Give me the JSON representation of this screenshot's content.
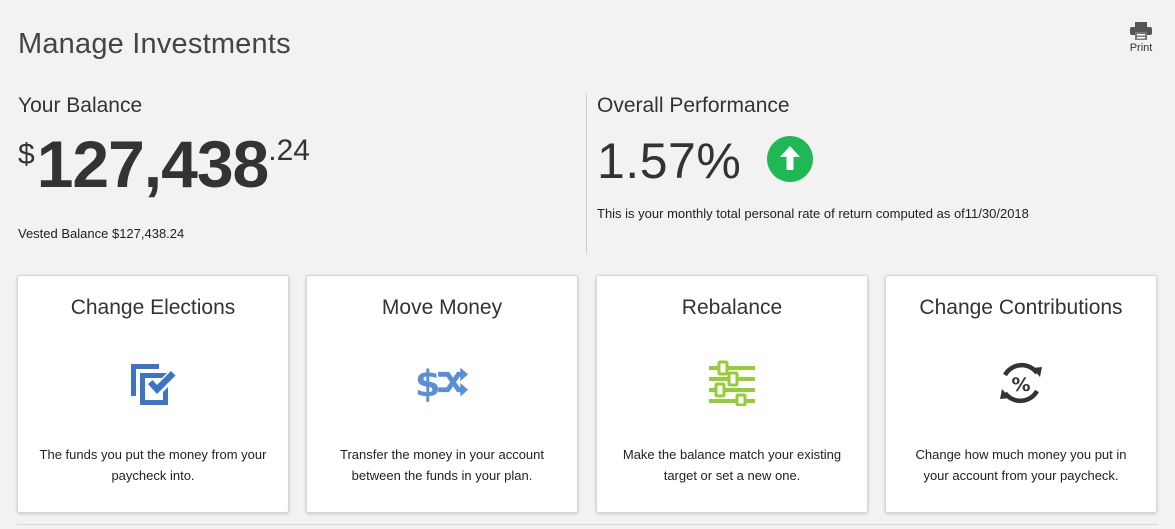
{
  "page": {
    "title": "Manage Investments",
    "print_label": "Print"
  },
  "balance": {
    "heading": "Your Balance",
    "currency_symbol": "$",
    "whole": "127,438",
    "cents": ".24",
    "vested_line": "Vested Balance $127,438.24"
  },
  "performance": {
    "heading": "Overall Performance",
    "value": "1.57%",
    "direction": "up",
    "direction_color": "#1eb954",
    "note": "This is your monthly total personal rate of return computed as of11/30/2018"
  },
  "cards": [
    {
      "title": "Change Elections",
      "icon": "checkbox-edit-icon",
      "icon_color": "#3d74c6",
      "description": "The funds you put the money from your paycheck into."
    },
    {
      "title": "Move Money",
      "icon": "dollar-shuffle-icon",
      "icon_color": "#5a8ed6",
      "description": "Transfer the money in your account between the funds in your plan."
    },
    {
      "title": "Rebalance",
      "icon": "sliders-icon",
      "icon_color": "#95cc3a",
      "description": "Make the balance match your existing target or set a new one."
    },
    {
      "title": "Change Contributions",
      "icon": "percent-cycle-icon",
      "icon_color": "#333333",
      "description": "Change how much money you put in your account from your paycheck."
    }
  ]
}
